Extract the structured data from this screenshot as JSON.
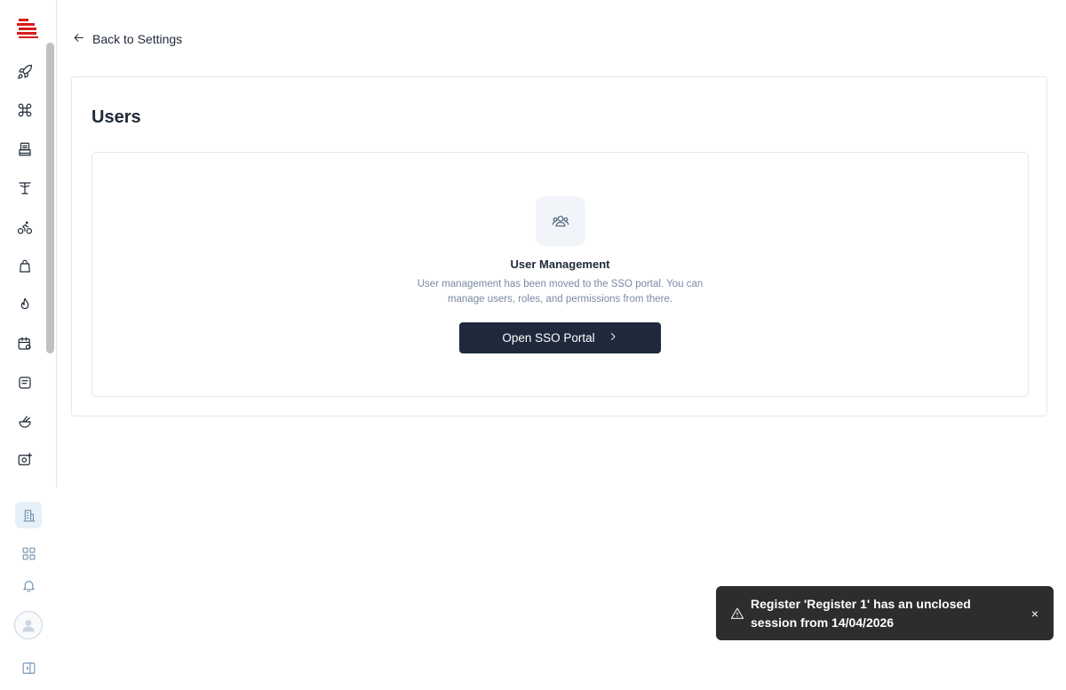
{
  "sidebar": {
    "logo": "app-logo",
    "nav_icons": [
      "rocket-icon",
      "command-icon",
      "printer-icon",
      "table-icon",
      "bike-icon",
      "bag-icon",
      "flame-icon",
      "calendar-settings-icon",
      "receipt-icon",
      "bowl-icon",
      "image-plus-icon"
    ],
    "bottom_icons": [
      "building-icon",
      "grid-icon",
      "bell-icon",
      "avatar-icon",
      "panel-toggle-icon"
    ]
  },
  "back_link": {
    "label": "Back to Settings",
    "icon": "arrow-left-icon"
  },
  "page": {
    "title": "Users",
    "feature": {
      "icon": "users-icon",
      "title": "User Management",
      "description": "User management has been moved to the SSO portal. You can manage users, roles, and permissions from there.",
      "button_label": "Open SSO Portal",
      "button_icon": "chevron-right-icon"
    }
  },
  "toast": {
    "icon": "alert-triangle-icon",
    "message": "Register 'Register 1' has an unclosed session from 14/04/2026",
    "close_label": "×"
  },
  "colors": {
    "primary_button": "#1e293b",
    "toast_bg": "#2d2d2d",
    "accent_logo": "#d91c1c"
  }
}
